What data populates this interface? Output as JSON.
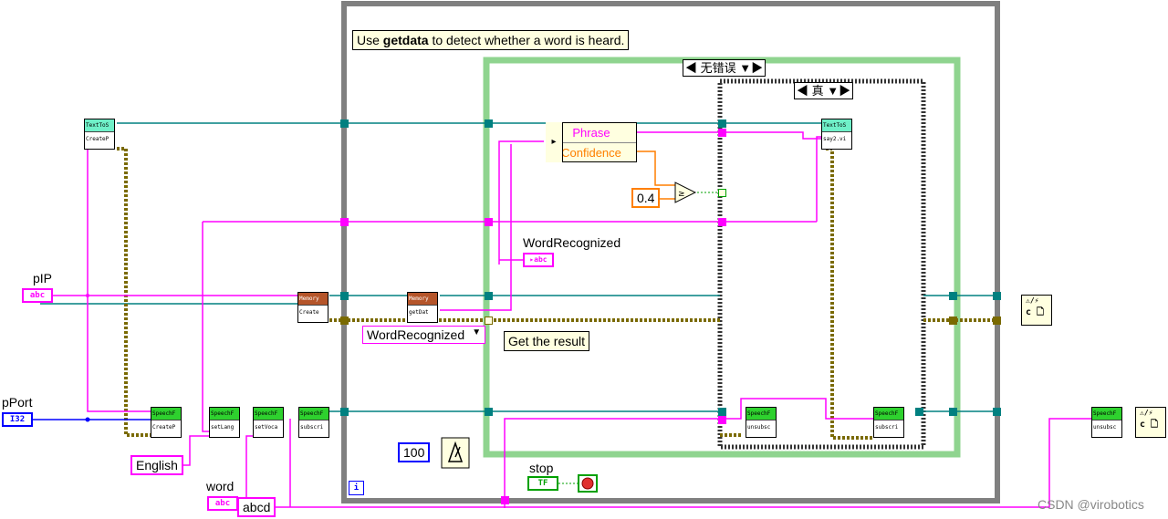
{
  "comment_getdata": "Use getdata to detect whether a word is heard.",
  "comment_getdata_bold": "getdata",
  "comment_result": "Get the result",
  "case_error_selector": "无错误",
  "case_true_selector": "真",
  "bundle": {
    "row1": "Phrase",
    "row2": "Confidence"
  },
  "threshold_value": "0.4",
  "wait_value": "100",
  "indicator_word_recognized": "WordRecognized",
  "enum_value": "WordRecognized",
  "stop_label": "stop",
  "control_pIP": "pIP",
  "control_pPort": "pPort",
  "control_word": "word",
  "const_english": "English",
  "const_abcd": "abcd",
  "terminal_abc": "abc",
  "terminal_i32": "I32",
  "terminal_tf": "TF",
  "loop_index": "i",
  "vi_labels": {
    "tts_create": [
      "TextToS",
      "CreateP"
    ],
    "speech_create": [
      "SpeechF",
      "CreateP"
    ],
    "speech_setlang": [
      "SpeechF",
      "setLang"
    ],
    "speech_setvoca": [
      "SpeechF",
      "setVoca"
    ],
    "speech_subscri": [
      "SpeechF",
      "subscri"
    ],
    "mem_create": [
      "Memory",
      "Create"
    ],
    "mem_getdat": [
      "Memory",
      "getDat"
    ],
    "tts_say": [
      "TextToS",
      "say2.vi"
    ],
    "speech_unsubsc_in": [
      "SpeechF",
      "unsubsc"
    ],
    "speech_subscri_in": [
      "SpeechF",
      "subscri"
    ],
    "speech_unsubsc_out": [
      "SpeechF",
      "unsubsc"
    ]
  },
  "watermark": "CSDN @virobotics",
  "colors": {
    "string_wire": "#ff00ff",
    "refnum_wire": "#008080",
    "error_wire": "#7a6a00",
    "int_wire": "#0000ff",
    "loop_frame": "#808080",
    "case_frame": "#8fd48f"
  }
}
